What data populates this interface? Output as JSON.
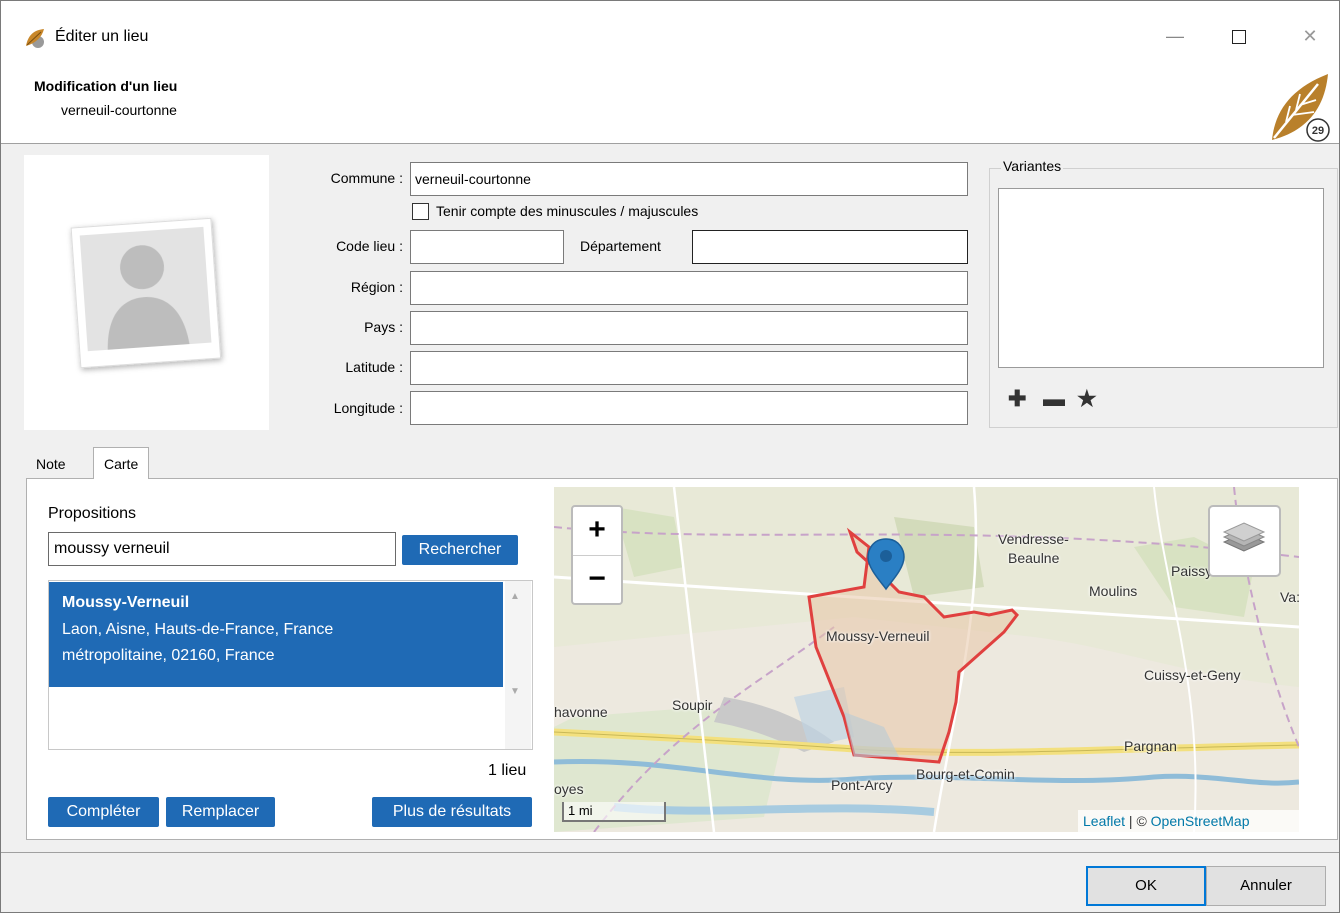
{
  "window": {
    "title": "Éditer un lieu",
    "minimize_icon": "minimize-icon",
    "maximize_icon": "maximize-icon",
    "close_icon": "close-icon"
  },
  "header": {
    "title": "Modification d'un lieu",
    "subtitle": "verneuil-courtonne",
    "logo_text": "29"
  },
  "form": {
    "commune_label": "Commune :",
    "commune_value": "verneuil-courtonne",
    "case_checkbox_label": "Tenir compte des minuscules / majuscules",
    "case_checkbox_checked": false,
    "code_label": "Code lieu :",
    "code_value": "",
    "departement_label": "Département",
    "departement_value": "",
    "region_label": "Région :",
    "region_value": "",
    "pays_label": "Pays :",
    "pays_value": "",
    "latitude_label": "Latitude :",
    "latitude_value": "",
    "longitude_label": "Longitude :",
    "longitude_value": ""
  },
  "variantes": {
    "title": "Variantes",
    "add_icon": "plus-icon",
    "remove_icon": "minus-icon",
    "favorite_icon": "star-icon"
  },
  "tabs": [
    {
      "label": "Note",
      "active": false
    },
    {
      "label": "Carte",
      "active": true
    }
  ],
  "carte": {
    "propositions_label": "Propositions",
    "search_value": "moussy verneuil",
    "search_button": "Rechercher",
    "results": [
      {
        "name": "Moussy-Verneuil",
        "address_line1": "Laon, Aisne, Hauts-de-France, France",
        "address_line2": "métropolitaine, 02160, France",
        "selected": true
      }
    ],
    "count": "1 lieu",
    "complete_button": "Compléter",
    "replace_button": "Remplacer",
    "more_button": "Plus de résultats"
  },
  "map": {
    "zoom_in": "+",
    "zoom_out": "−",
    "scale": "1 mi",
    "attribution_leaflet": "Leaflet",
    "attribution_sep": " | © ",
    "attribution_osm": "OpenStreetMap",
    "places": {
      "vendresse": "Vendresse-",
      "beaulne": "Beaulne",
      "paissy": "Paissy",
      "moulins": "Moulins",
      "vas": "Va:",
      "moussy": "Moussy-Verneuil",
      "cuissy": "Cuissy-et-Geny",
      "soupir": "Soupir",
      "chavonne": "havonne",
      "pargnan": "Pargnan",
      "pontarcy": "Pont-Arcy",
      "bourg": "Bourg-et-Comin",
      "oyes": "oyes"
    },
    "colors": {
      "boundary": "#e0403f",
      "marker": "#2a7fc4",
      "road": "#f5e68a"
    }
  },
  "footer": {
    "ok_button": "OK",
    "cancel_button": "Annuler"
  }
}
